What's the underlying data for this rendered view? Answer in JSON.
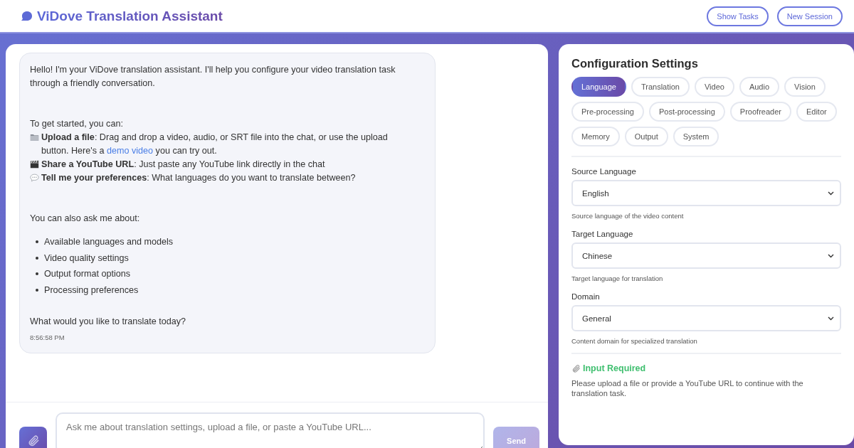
{
  "header": {
    "title": "ViDove Translation Assistant",
    "buttons": [
      "Show Tasks",
      "New Session"
    ]
  },
  "chat": {
    "message": {
      "intro": "Hello! I'm your ViDove translation assistant. I'll help you configure your video translation task through a friendly conversation.",
      "lead": "To get started, you can:",
      "actions": [
        {
          "kind": "folder",
          "text": "**Upload a file**: Drag and drop a video, audio, or SRT file into the chat, or use the upload button. Here's a ",
          "link": "demo video",
          "after": " you can try out."
        },
        {
          "kind": "clapper",
          "text": "**Share a YouTube URL**: Just paste any YouTube link directly in the chat"
        },
        {
          "kind": "speech",
          "text": "**Tell me your preferences**: What languages do you want to translate between?"
        }
      ],
      "also": "You can also ask me about:",
      "bullets": [
        "Available languages and models",
        "Video quality settings",
        "Output format options",
        "Processing preferences"
      ],
      "closing": "What would you like to translate today?",
      "time": "8:56:58 PM"
    },
    "input": {
      "placeholder": "Ask me about translation settings, upload a file, or paste a YouTube URL..."
    },
    "send": {
      "label": "Send",
      "disabled": true
    }
  },
  "config": {
    "title": "Configuration Settings",
    "tabs": [
      {
        "label": "Language",
        "selected": true
      },
      {
        "label": "Translation",
        "selected": false
      },
      {
        "label": "Video",
        "selected": false
      },
      {
        "label": "Audio",
        "selected": false
      },
      {
        "label": "Vision",
        "selected": false
      },
      {
        "label": "Pre-processing",
        "selected": false
      },
      {
        "label": "Post-processing",
        "selected": false
      },
      {
        "label": "Proofreader",
        "selected": false
      },
      {
        "label": "Editor",
        "selected": false
      },
      {
        "label": "Memory",
        "selected": false
      },
      {
        "label": "Output",
        "selected": false
      },
      {
        "label": "System",
        "selected": false
      }
    ],
    "fields": [
      {
        "label": "Source Language",
        "value": "English",
        "help": "Source language of the video content"
      },
      {
        "label": "Target Language",
        "value": "Chinese",
        "help": "Target language for translation"
      },
      {
        "label": "Domain",
        "value": "General",
        "help": "Content domain for specialized translation"
      }
    ],
    "notice": {
      "title": "Input Required",
      "text": "Please upload a file or provide a YouTube URL to continue with the translation task."
    }
  }
}
